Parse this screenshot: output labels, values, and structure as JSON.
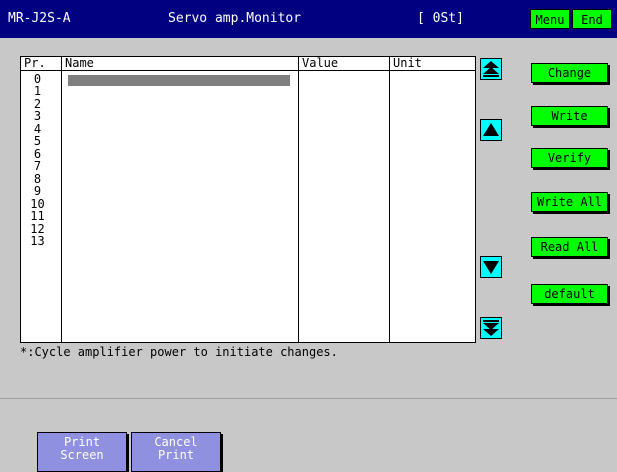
{
  "header": {
    "model": "MR-J2S-A",
    "title": "Servo amp.Monitor",
    "status": "[ 0St]",
    "menu_label": "Menu",
    "end_label": "End"
  },
  "table": {
    "columns": [
      "Pr.",
      "Name",
      "Value",
      "Unit"
    ],
    "rows": [
      "0",
      "1",
      "2",
      "3",
      "4",
      "5",
      "6",
      "7",
      "8",
      "9",
      "10",
      "11",
      "12",
      "13"
    ]
  },
  "scroll": {
    "top_icon": "double-up-arrow-icon",
    "up_icon": "up-arrow-icon",
    "down_icon": "down-arrow-icon",
    "bottom_icon": "double-down-arrow-icon"
  },
  "actions": {
    "change": "Change",
    "write": "Write",
    "verify": "Verify",
    "write_all": "Write All",
    "read_all": "Read All",
    "default": "default"
  },
  "note": "*:Cycle amplifier power to initiate changes.",
  "footer": {
    "print_line1": "Print",
    "print_line2": "Screen",
    "cancel_line1": "Cancel",
    "cancel_line2": "Print"
  },
  "colors": {
    "titlebar": "#000080",
    "button_green": "#00ff00",
    "scroll_cyan": "#00ffff",
    "footer_button": "#9090e0"
  }
}
